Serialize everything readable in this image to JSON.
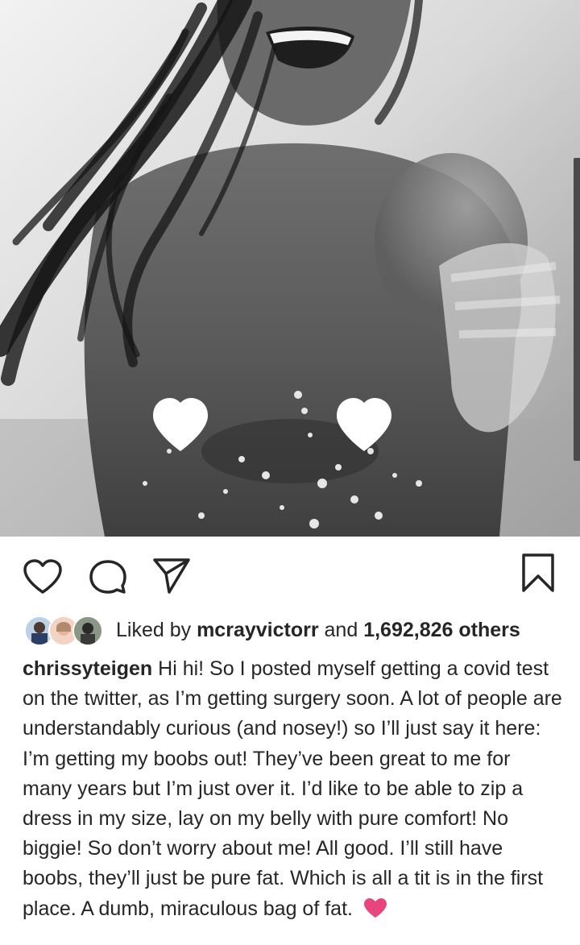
{
  "post": {
    "photo_alt": "black-and-white beach photo with white heart stickers",
    "actions": {
      "like_icon": "heart-outline-icon",
      "comment_icon": "comment-bubble-icon",
      "share_icon": "paper-plane-icon",
      "save_icon": "bookmark-icon"
    },
    "likes": {
      "prefix": "Liked by",
      "first_liker": "mcrayvictorr",
      "connector": "and",
      "others_count": "1,692,826 others"
    },
    "caption": {
      "username": "chrissyteigen",
      "text": "Hi hi! So I posted myself getting a covid test on the twitter, as I’m getting surgery soon. A lot of people are understandably curious (and nosey!) so I’ll just say it here: I’m getting my boobs out! They’ve been great to me for many years but I’m just over it. I’d like to be able to zip a dress in my size, lay on my belly with pure comfort! No biggie! So don’t worry about me! All good. I’ll still have boobs, they’ll just be pure fat. Which is all a tit is in the first place. A dumb, miraculous bag of fat.",
      "emoji": "pink-heart-icon"
    }
  },
  "colors": {
    "text": "#262626",
    "emoji_heart": "#e8457e"
  }
}
